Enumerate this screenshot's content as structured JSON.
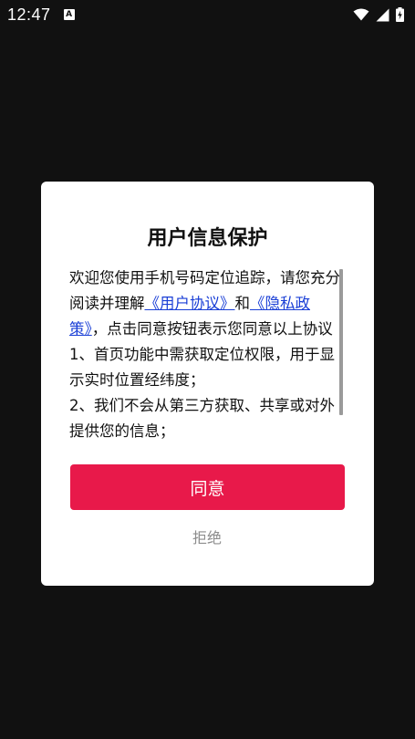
{
  "status_bar": {
    "time": "12:47",
    "notification_icon_letter": "A",
    "icons": [
      "wifi-icon",
      "signal-icon",
      "battery-charging-icon"
    ]
  },
  "dialog": {
    "title": "用户信息保护",
    "content": {
      "intro": "欢迎您使用手机号码定位追踪，请您充分阅读并理解",
      "user_agreement_link": "《用户协议》",
      "and": "和",
      "privacy_policy_link": "《隐私政策》",
      "after_links": "，点击同意按钮表示您同意以上协议",
      "item_1": "1、首页功能中需获取定位权限，用于显示实时位置经纬度；",
      "item_2": "2、我们不会从第三方获取、共享或对外提供您的信息；"
    },
    "agree_label": "同意",
    "reject_label": "拒绝"
  },
  "colors": {
    "backdrop": "#111111",
    "dialog_bg": "#ffffff",
    "accent": "#e8194a",
    "link": "#1a3fd6",
    "muted": "#8c8c8c"
  }
}
